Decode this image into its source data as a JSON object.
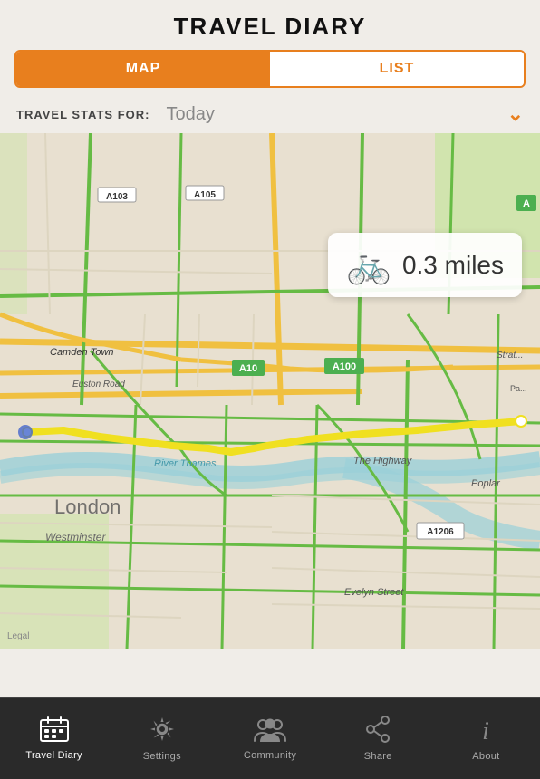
{
  "header": {
    "title": "TRAVEL DIARY"
  },
  "tabs": [
    {
      "label": "MAP",
      "active": true
    },
    {
      "label": "LIST",
      "active": false
    }
  ],
  "stats": {
    "label": "TRAVEL STATS FOR:",
    "value": "Today",
    "chevron": "⌄"
  },
  "map": {
    "distance": "0.3 miles",
    "transport_icon": "🚲"
  },
  "bottom_nav": [
    {
      "id": "travel-diary",
      "label": "Travel Diary",
      "icon": "📅",
      "active": true
    },
    {
      "id": "settings",
      "label": "Settings",
      "icon": "⚙",
      "active": false
    },
    {
      "id": "community",
      "label": "Community",
      "icon": "👥",
      "active": false
    },
    {
      "id": "share",
      "label": "Share",
      "icon": "⎋",
      "active": false
    },
    {
      "id": "about",
      "label": "About",
      "icon": "ⓘ",
      "active": false
    }
  ]
}
